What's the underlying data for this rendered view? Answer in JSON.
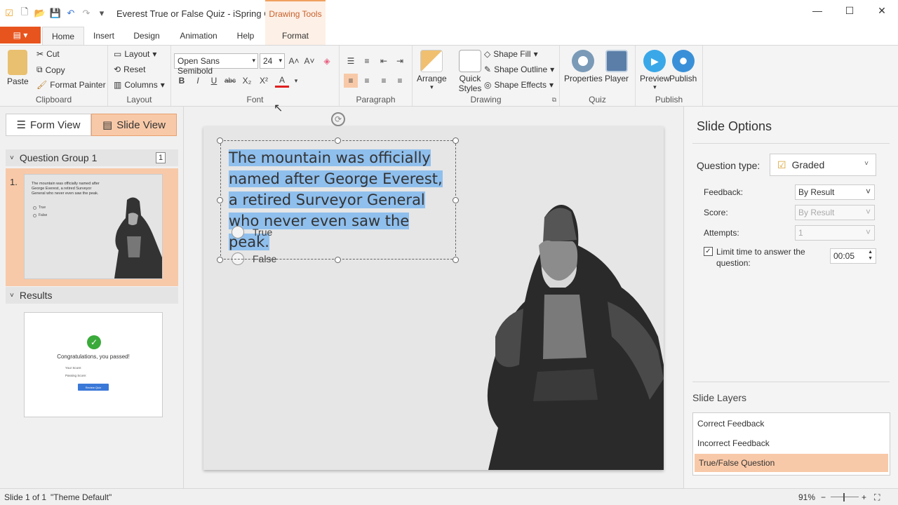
{
  "window": {
    "title": "Everest True or False Quiz - iSpring Q...",
    "context_tab": "Drawing Tools"
  },
  "tabs": [
    "Home",
    "Insert",
    "Design",
    "Animation",
    "Help",
    "Format"
  ],
  "ribbon": {
    "clipboard": {
      "paste": "Paste",
      "cut": "Cut",
      "copy": "Copy",
      "format_painter": "Format Painter",
      "label": "Clipboard"
    },
    "layout": {
      "layout": "Layout",
      "reset": "Reset",
      "columns": "Columns",
      "label": "Layout"
    },
    "font": {
      "family": "Open Sans Semibold",
      "size": "24",
      "label": "Font"
    },
    "paragraph": {
      "label": "Paragraph"
    },
    "drawing": {
      "arrange": "Arrange",
      "quick_styles": "Quick Styles",
      "shape_fill": "Shape Fill",
      "shape_outline": "Shape Outline",
      "shape_effects": "Shape Effects",
      "label": "Drawing"
    },
    "quiz": {
      "properties": "Properties",
      "player": "Player",
      "label": "Quiz"
    },
    "publish": {
      "preview": "Preview",
      "publish": "Publish",
      "label": "Publish"
    }
  },
  "left_panel": {
    "form_view": "Form View",
    "slide_view": "Slide View",
    "group_title": "Question Group 1",
    "group_count": "1",
    "slide_number": "1.",
    "thumb_text": "The mountain was officially named after George Everest, a retired Surveyor General who never even saw the peak.",
    "thumb_true": "True",
    "thumb_false": "False",
    "results_title": "Results",
    "results_congrats": "Congratulations, you passed!",
    "results_your_score": "Your Score:",
    "results_passing_score": "Passing Score:",
    "results_review": "Review Quiz"
  },
  "slide": {
    "question": "The mountain was officially named after George Everest, a retired Surveyor General who never even saw the peak.",
    "options": [
      "True",
      "False"
    ]
  },
  "slide_options": {
    "title": "Slide Options",
    "question_type_label": "Question type:",
    "question_type": "Graded",
    "feedback_label": "Feedback:",
    "feedback": "By Result",
    "score_label": "Score:",
    "score": "By Result",
    "attempts_label": "Attempts:",
    "attempts": "1",
    "limit_time_label": "Limit time to answer the question:",
    "limit_time_checked": true,
    "limit_time_value": "00:05"
  },
  "slide_layers": {
    "title": "Slide Layers",
    "items": [
      "Correct Feedback",
      "Incorrect Feedback",
      "True/False Question"
    ],
    "selected": "True/False Question"
  },
  "status": {
    "slide": "Slide 1 of 1",
    "theme": "\"Theme Default\"",
    "zoom": "91%"
  },
  "colors": {
    "accent": "#e8541e",
    "selection": "#f8c9a8",
    "highlight": "#8fbfed"
  }
}
